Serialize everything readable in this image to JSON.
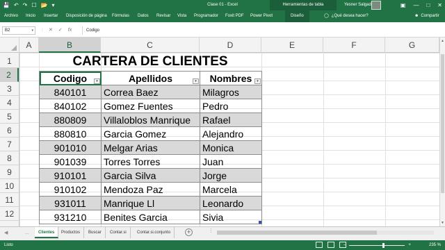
{
  "window": {
    "title": "Clase 01  -  Excel",
    "contextual_tools": "Herramientas de tabla",
    "user_name": "Yesner Salgado",
    "quick_access": [
      "save-icon",
      "undo-icon",
      "redo-icon",
      "new-file-icon",
      "open-icon",
      "more-icon"
    ],
    "window_controls": [
      "ribbon-display-icon",
      "minimize-icon",
      "restore-icon",
      "close-icon"
    ]
  },
  "ribbon": {
    "tabs": [
      "Archivo",
      "Inicio",
      "Insertar",
      "Disposición de página",
      "Fórmulas",
      "Datos",
      "Revisar",
      "Vista",
      "Programador",
      "Foxit PDF",
      "Power Pivot",
      "Diseño"
    ],
    "tell_me": "¿Qué desea hacer?",
    "share": "Compartir"
  },
  "formula_bar": {
    "name_box": "B2",
    "formula": "Codigo",
    "cancel_glyph": "✕",
    "enter_glyph": "✓",
    "fx_glyph": "fx"
  },
  "grid": {
    "columns": [
      "A",
      "B",
      "C",
      "D",
      "E",
      "F",
      "G"
    ],
    "rows": [
      "1",
      "2",
      "3",
      "4",
      "5",
      "6",
      "7",
      "8",
      "9",
      "10",
      "11",
      "12"
    ],
    "selected_column": "B",
    "selected_row": "2"
  },
  "sheet": {
    "title": "CARTERA DE CLIENTES",
    "headers": [
      "Codigo",
      "Apellidos",
      "Nombres"
    ],
    "records": [
      {
        "codigo": "840101",
        "apellidos": "Correa Baez",
        "nombres": "Milagros"
      },
      {
        "codigo": "840102",
        "apellidos": "Gomez Fuentes",
        "nombres": "Pedro"
      },
      {
        "codigo": "880809",
        "apellidos": "Villaloblos Manrique",
        "nombres": "Rafael"
      },
      {
        "codigo": "880810",
        "apellidos": "Garcia Gomez",
        "nombres": "Alejandro"
      },
      {
        "codigo": "901010",
        "apellidos": "Melgar Arias",
        "nombres": "Monica"
      },
      {
        "codigo": "901039",
        "apellidos": "Torres Torres",
        "nombres": "Juan"
      },
      {
        "codigo": "910101",
        "apellidos": "Garcia Silva",
        "nombres": "Jorge"
      },
      {
        "codigo": "910102",
        "apellidos": "Mendoza Paz",
        "nombres": "Marcela"
      },
      {
        "codigo": "931011",
        "apellidos": "Manrique Ll",
        "nombres": "Leonardo"
      },
      {
        "codigo": "931210",
        "apellidos": "Benites Garcia",
        "nombres": "Sivia"
      }
    ]
  },
  "sheet_tabs": {
    "tabs": [
      "Clientes",
      "Productos",
      "Buscar",
      "Contar.si",
      "Contar.si.conjunto"
    ],
    "active": "Clientes",
    "more": "..."
  },
  "status_bar": {
    "status": "Listo",
    "zoom": "235 %"
  },
  "colors": {
    "excel_green": "#217346",
    "band_gray": "#d9d9d9",
    "header_gray": "#f3f3f3"
  }
}
